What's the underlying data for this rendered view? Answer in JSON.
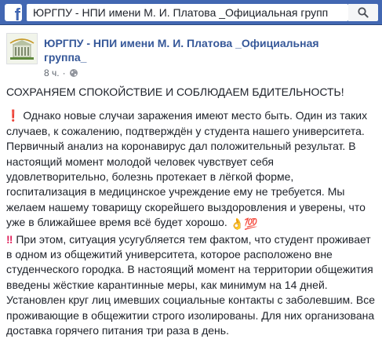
{
  "topbar": {
    "logo_icon": "facebook-f-icon",
    "search_value": "ЮРГПУ - НПИ имени М. И. Платова _Официальная групп",
    "search_icon": "search-icon"
  },
  "post": {
    "page_name": "ЮРГПУ - НПИ имени М. И. Платова _Официальная группа_",
    "time": "8 ч.",
    "separator": "·",
    "privacy_icon": "globe-icon",
    "headline": "СОХРАНЯЕМ СПОКОЙСТВИЕ И СОБЛЮДАЕМ БДИТЕЛЬНОСТЬ!",
    "para1_emoji": "❗",
    "para1": "Однако новые случаи заражения имеют место быть. Один из таких случаев, к сожалению, подтверждён у студента нашего университета. Первичный анализ на коронавирус дал положительный результат. В настоящий момент молодой человек чувствует себя удовлетворительно, болезнь протекает в лёгкой форме, госпитализация в медицинское учреждение ему не требуется. Мы желаем нашему товарищу скорейшего выздоровления и уверены, что уже в ближайшее время всё будет хорошо.",
    "para1_emoji_end_1": "👌",
    "para1_emoji_end_2": "💯",
    "para2_emoji": "‼",
    "para2": "При этом, ситуация усугубляется тем фактом, что студент проживает в одном из общежитий университета, которое расположено вне студенческого городка. В настоящий момент на территории общежития введены жёсткие карантинные меры, как минимум на 14 дней. Установлен круг лиц имевших социальные контакты с заболевшим. Все проживающие в общежитии строго изолированы. Для них организована доставка горячего питания три раза в день."
  }
}
